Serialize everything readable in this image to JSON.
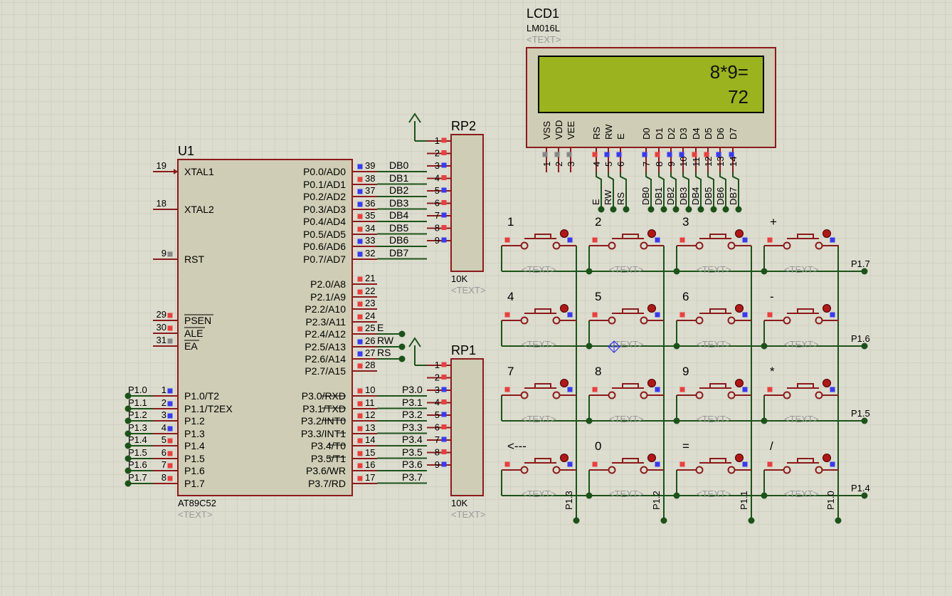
{
  "colors": {
    "background": "#dcdccf",
    "grid": "#c9c9bb",
    "wire": "#1c5219",
    "pin": "#8b1b1b",
    "chip_fill": "#cfcdb5",
    "lcd_screen": "#9bb31f",
    "text": "#000000",
    "placeholder": "#9a9a9a",
    "pin_blue": "#3a3aee",
    "pin_red": "#e84040",
    "pin_gray": "#888888"
  },
  "u1": {
    "ref": "U1",
    "part": "AT89C52",
    "text_placeholder": "<TEXT>",
    "left_pins": [
      {
        "num": "19",
        "name": "XTAL1"
      },
      {
        "num": "18",
        "name": "XTAL2"
      },
      {
        "num": "9",
        "name": "RST"
      },
      {
        "num": "29",
        "name": "PSEN"
      },
      {
        "num": "30",
        "name": "ALE"
      },
      {
        "num": "31",
        "name": "EA"
      },
      {
        "num": "1",
        "name": "P1.0/T2",
        "net": "P1.0"
      },
      {
        "num": "2",
        "name": "P1.1/T2EX",
        "net": "P1.1"
      },
      {
        "num": "3",
        "name": "P1.2",
        "net": "P1.2"
      },
      {
        "num": "4",
        "name": "P1.3",
        "net": "P1.3"
      },
      {
        "num": "5",
        "name": "P1.4",
        "net": "P1.4"
      },
      {
        "num": "6",
        "name": "P1.5",
        "net": "P1.5"
      },
      {
        "num": "7",
        "name": "P1.6",
        "net": "P1.6"
      },
      {
        "num": "8",
        "name": "P1.7",
        "net": "P1.7"
      }
    ],
    "right_pins": [
      {
        "num": "39",
        "name": "P0.0/AD0",
        "net": "DB0"
      },
      {
        "num": "38",
        "name": "P0.1/AD1",
        "net": "DB1"
      },
      {
        "num": "37",
        "name": "P0.2/AD2",
        "net": "DB2"
      },
      {
        "num": "36",
        "name": "P0.3/AD3",
        "net": "DB3"
      },
      {
        "num": "35",
        "name": "P0.4/AD4",
        "net": "DB4"
      },
      {
        "num": "34",
        "name": "P0.5/AD5",
        "net": "DB5"
      },
      {
        "num": "33",
        "name": "P0.6/AD6",
        "net": "DB6"
      },
      {
        "num": "32",
        "name": "P0.7/AD7",
        "net": "DB7"
      },
      {
        "num": "21",
        "name": "P2.0/A8",
        "net": ""
      },
      {
        "num": "22",
        "name": "P2.1/A9",
        "net": ""
      },
      {
        "num": "23",
        "name": "P2.2/A10",
        "net": ""
      },
      {
        "num": "24",
        "name": "P2.3/A11",
        "net": ""
      },
      {
        "num": "25",
        "name": "P2.4/A12",
        "net": "E"
      },
      {
        "num": "26",
        "name": "P2.5/A13",
        "net": "RW"
      },
      {
        "num": "27",
        "name": "P2.6/A14",
        "net": "RS"
      },
      {
        "num": "28",
        "name": "P2.7/A15",
        "net": ""
      },
      {
        "num": "10",
        "name": "P3.0/RXD",
        "net": "P3.0"
      },
      {
        "num": "11",
        "name": "P3.1/TXD",
        "net": "P3.1"
      },
      {
        "num": "12",
        "name": "P3.2/INT0",
        "net": "P3.2"
      },
      {
        "num": "13",
        "name": "P3.3/INT1",
        "net": "P3.3"
      },
      {
        "num": "14",
        "name": "P3.4/T0",
        "net": "P3.4"
      },
      {
        "num": "15",
        "name": "P3.5/T1",
        "net": "P3.5"
      },
      {
        "num": "16",
        "name": "P3.6/WR",
        "net": "P3.6"
      },
      {
        "num": "17",
        "name": "P3.7/RD",
        "net": "P3.7"
      }
    ]
  },
  "rp2": {
    "ref": "RP2",
    "value": "10K",
    "text_placeholder": "<TEXT>",
    "pins": [
      "1",
      "2",
      "3",
      "4",
      "5",
      "6",
      "7",
      "8",
      "9"
    ]
  },
  "rp1": {
    "ref": "RP1",
    "value": "10K",
    "text_placeholder": "<TEXT>",
    "pins": [
      "1",
      "2",
      "3",
      "4",
      "5",
      "6",
      "7",
      "8",
      "9"
    ]
  },
  "lcd": {
    "ref": "LCD1",
    "part": "LM016L",
    "text_placeholder": "<TEXT>",
    "line1": "8*9=",
    "line2": "72",
    "pin_labels": [
      "VSS",
      "VDD",
      "VEE",
      "RS",
      "RW",
      "E",
      "D0",
      "D1",
      "D2",
      "D3",
      "D4",
      "D5",
      "D6",
      "D7"
    ],
    "pin_numbers": [
      "1",
      "2",
      "3",
      "4",
      "5",
      "6",
      "7",
      "8",
      "9",
      "10",
      "11",
      "12",
      "13",
      "14"
    ],
    "net_labels": [
      "E",
      "RW",
      "RS",
      "DB0",
      "DB1",
      "DB2",
      "DB3",
      "DB4",
      "DB5",
      "DB6",
      "DB7"
    ]
  },
  "keypad": {
    "keys": [
      "1",
      "2",
      "3",
      "+",
      "4",
      "5",
      "6",
      "-",
      "7",
      "8",
      "9",
      "*",
      "<---",
      "0",
      "=",
      "/"
    ],
    "text_placeholder": "<TEXT>",
    "row_nets": [
      "P1.7",
      "P1.6",
      "P1.5",
      "P1.4"
    ],
    "col_nets": [
      "P1.3",
      "P1.2",
      "P1.1",
      "P1.0"
    ]
  }
}
